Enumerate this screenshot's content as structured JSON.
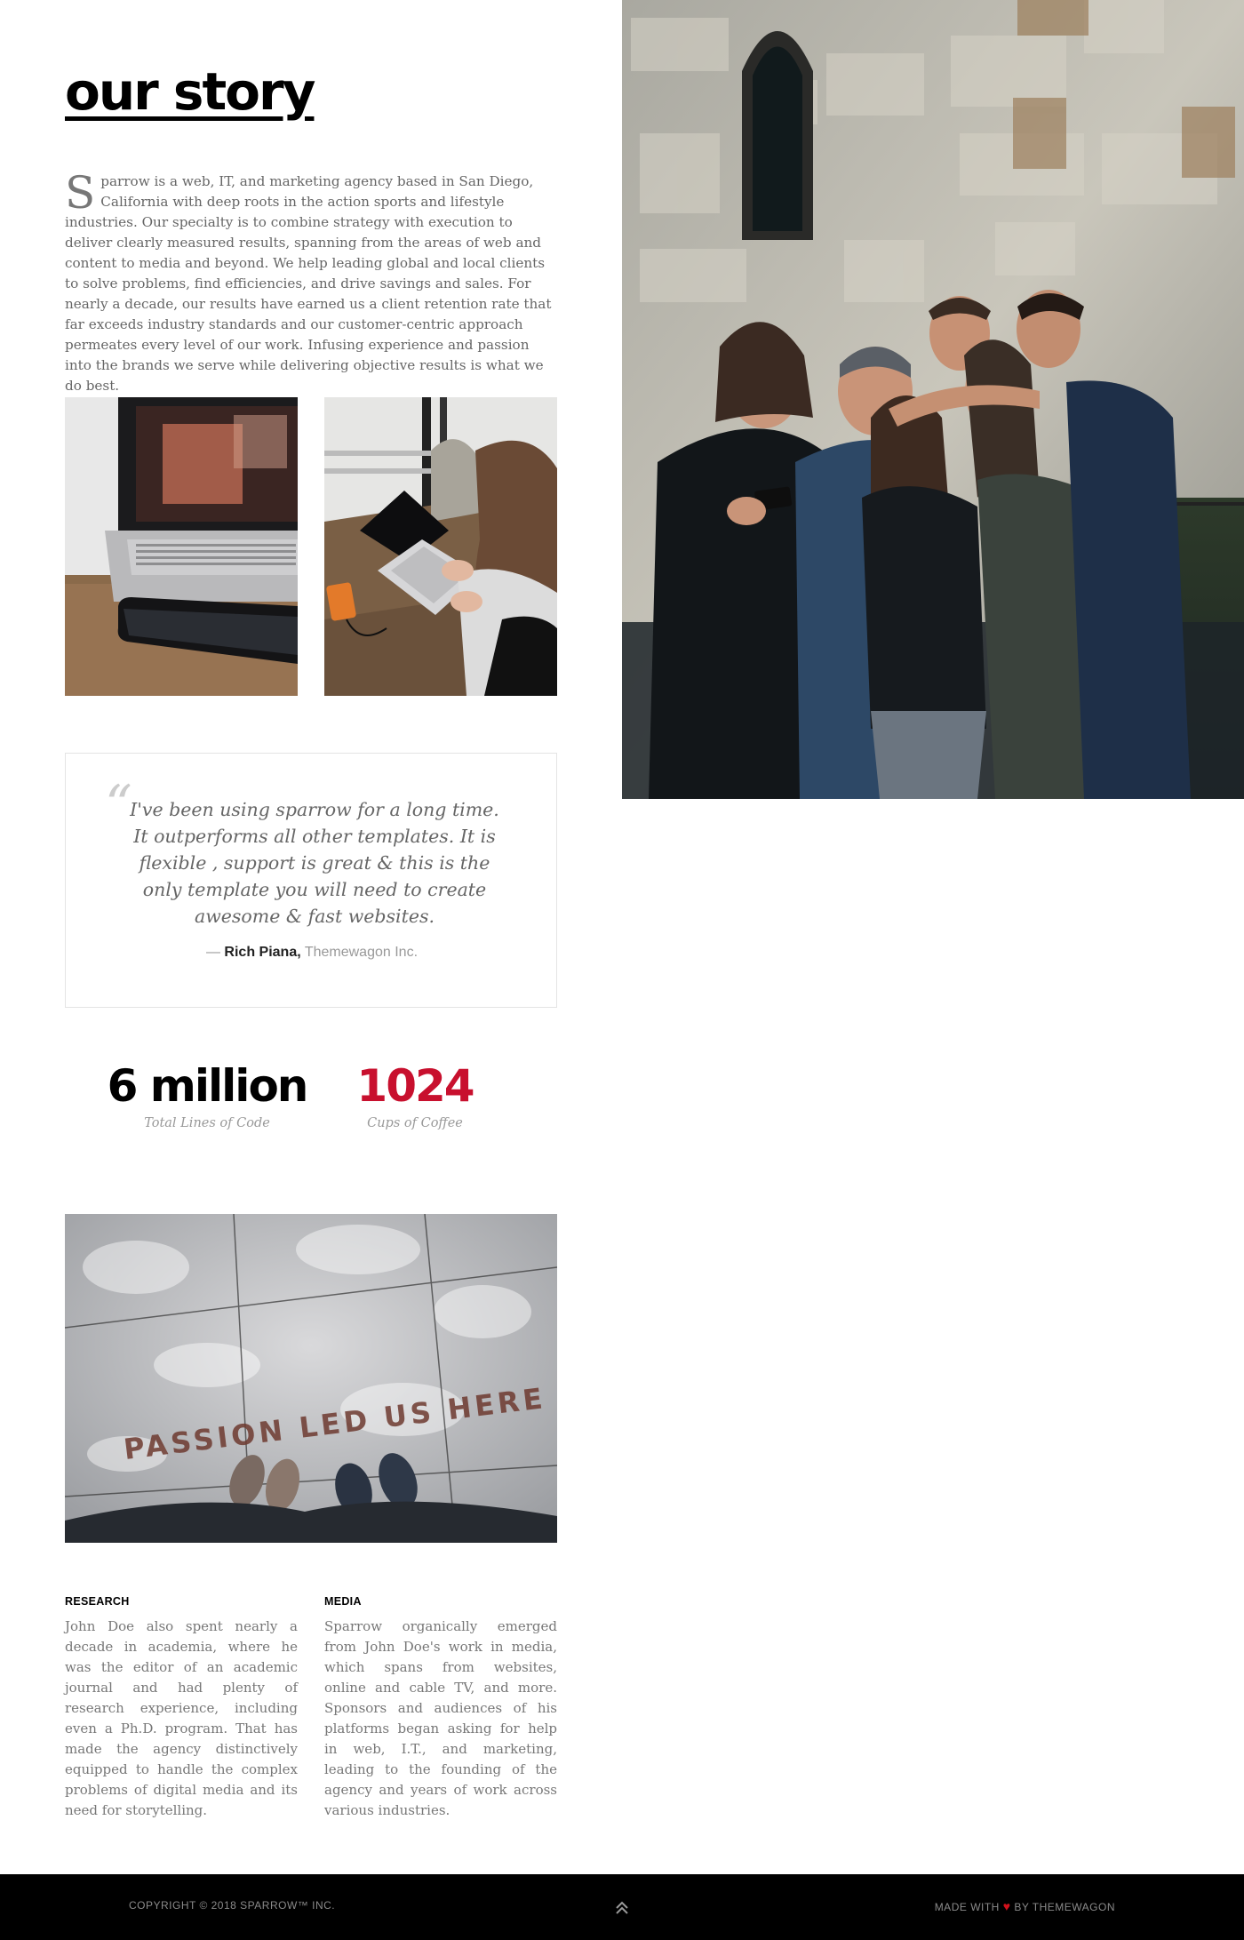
{
  "page": {
    "title": "our story",
    "intro_dropcap": "S",
    "intro_text": "parrow is a web, IT, and marketing agency based in San Diego, California with deep roots in the action sports and lifestyle industries. Our specialty is to combine strategy with execution to deliver clearly measured results, spanning from the areas of web and content to media and beyond. We help leading global and local clients to solve problems, find efficiencies, and drive savings and sales. For nearly a decade, our results have earned us a client retention rate that far exceeds industry standards and our customer-centric approach permeates every level of our work. Infusing experience and passion into the brands we serve while delivering objective results is what we do best."
  },
  "images": {
    "team_photo": "group-selfie-photo",
    "laptop_phone": "laptop-and-phone-photo",
    "woman_laptop": "woman-working-on-laptop-photo",
    "passion": {
      "alt": "passion-led-us-here-photo",
      "text": "PASSION LED US HERE"
    }
  },
  "testimonial": {
    "mark": "“",
    "quote": "I've been using sparrow for a long time. It outperforms all other templates. It is flexible , support is great & this is the only template you will need to create awesome & fast websites.",
    "dash": "— ",
    "author": "Rich Piana,",
    "company": "Themewagon Inc."
  },
  "stats": [
    {
      "value": "6 million",
      "label": "Total Lines of Code"
    },
    {
      "value": "1024",
      "label": "Cups of Coffee"
    }
  ],
  "columns": [
    {
      "heading": "RESEARCH",
      "text": "John Doe also spent nearly a decade in academia, where he was the editor of an academic journal and had plenty of research experience, including even a Ph.D. program. That has made the agency distinctively equipped to handle the complex problems of digital media and its need for storytelling."
    },
    {
      "heading": "MEDIA",
      "text": "Sparrow organically emerged from John Doe's work in media, which spans from websites, online and cable TV, and more. Sponsors and audiences of his platforms began asking for help in web, I.T., and marketing, leading to the founding of the agency and years of work across various industries."
    }
  ],
  "footer": {
    "copyright": "COPYRIGHT © 2018 SPARROW™ INC.",
    "made_with": "MADE WITH",
    "heart": "♥",
    "by": "BY THEMEWAGON",
    "back_to_top_icon": "double-chevron-up-icon"
  },
  "colors": {
    "accent": "#c8102e",
    "footer_bg": "#000000",
    "heart": "#d0111b"
  }
}
